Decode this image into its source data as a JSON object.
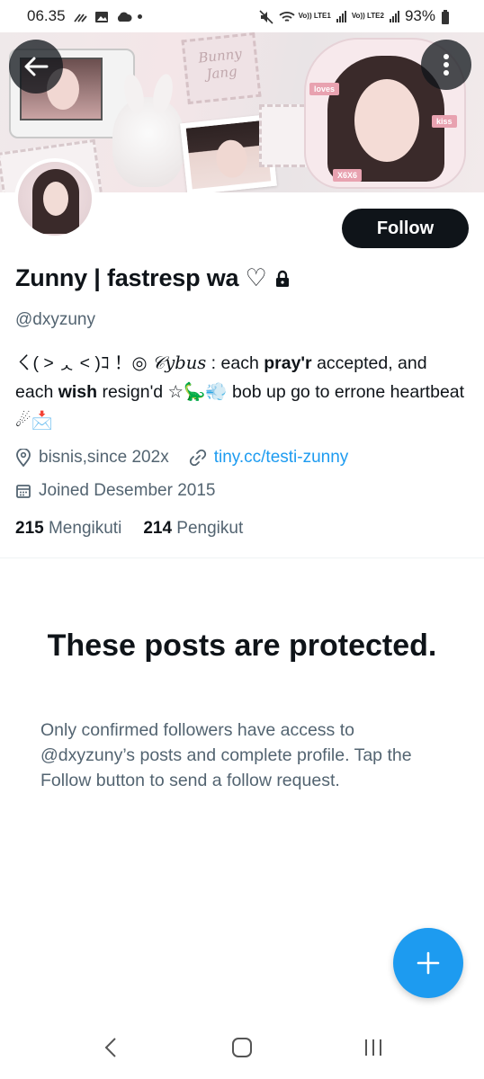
{
  "status_bar": {
    "time": "06.35",
    "lte1": "Vo)) LTE1",
    "lte2": "Vo)) LTE2",
    "battery": "93%"
  },
  "banner": {
    "stamp_text_1": "Bunny",
    "stamp_text_2": "Jang",
    "tag_loves": "loves",
    "tag_kiss": "kiss",
    "tag_xoxo": "X6X6"
  },
  "profile": {
    "display_name": "Zunny | fastresp wa ♡",
    "handle": "@dxyzuny",
    "follow_label": "Follow",
    "bio": {
      "part1": "ㄑ( ˃ ᆺ ˂ )ｺ ！◎ ",
      "script": "𝒞ybus",
      "part2": " : each ",
      "bold1": "pray'r",
      "part3": " accepted, and each ",
      "bold2": "wish",
      "part4": " resign'd ☆🦕💨 bob up go to errone heartbeat ☄📩"
    },
    "location": "bisnis,since 202x",
    "link": "tiny.cc/testi-zunny",
    "joined": "Joined Desember 2015",
    "following_count": "215",
    "following_label": "Mengikuti",
    "followers_count": "214",
    "followers_label": "Pengikut"
  },
  "protected": {
    "title": "These posts are protected.",
    "description": "Only confirmed followers have access to @dxyzuny’s posts and complete profile. Tap the Follow button to send a follow request."
  },
  "colors": {
    "accent": "#1d9bf0",
    "text_primary": "#0f1419",
    "text_secondary": "#536471"
  }
}
